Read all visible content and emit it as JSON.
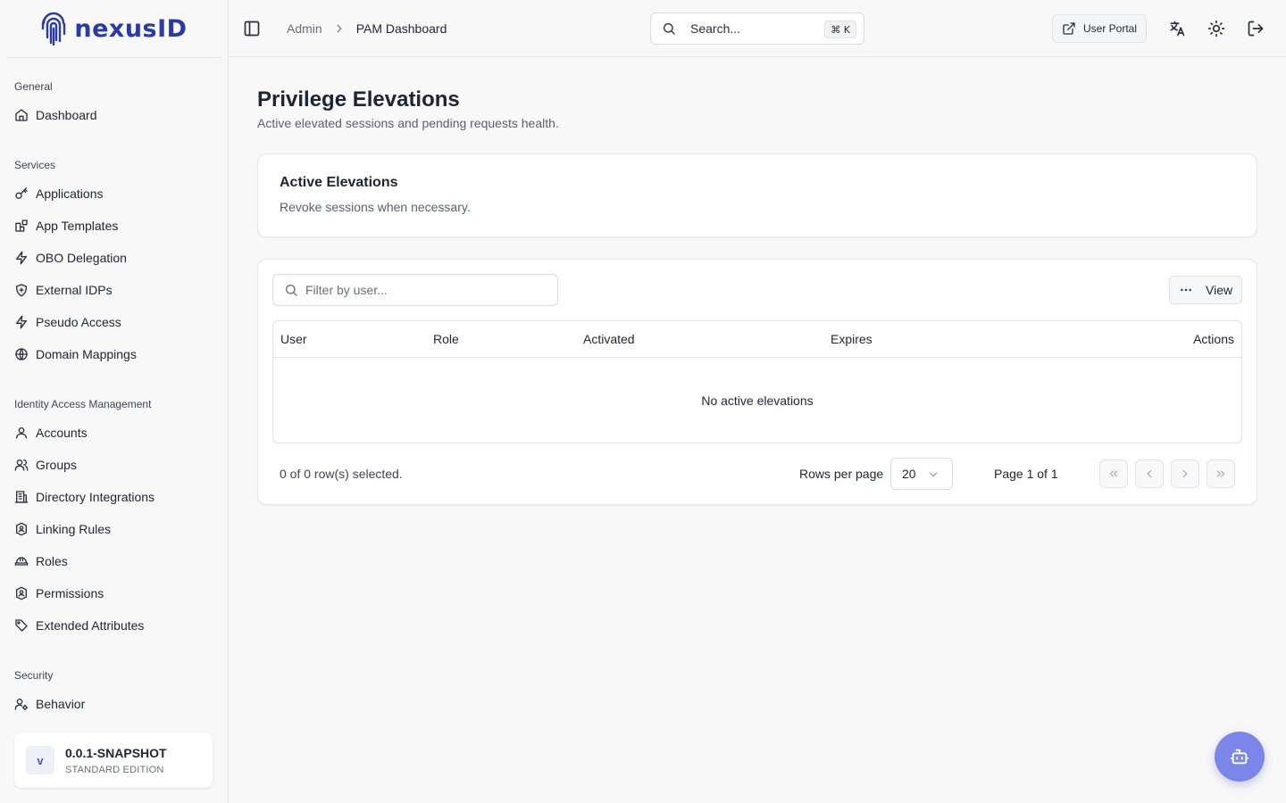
{
  "app": {
    "logo_text": "nexusID"
  },
  "sidebar": {
    "sections": [
      {
        "heading": "General",
        "items": [
          {
            "label": "Dashboard",
            "icon": "home-icon"
          }
        ]
      },
      {
        "heading": "Services",
        "items": [
          {
            "label": "Applications",
            "icon": "key-icon"
          },
          {
            "label": "App Templates",
            "icon": "blocks-icon"
          },
          {
            "label": "OBO Delegation",
            "icon": "zap-icon"
          },
          {
            "label": "External IDPs",
            "icon": "shield-plus-icon"
          },
          {
            "label": "Pseudo Access",
            "icon": "zap-icon"
          },
          {
            "label": "Domain Mappings",
            "icon": "globe-icon"
          }
        ]
      },
      {
        "heading": "Identity Access Management",
        "items": [
          {
            "label": "Accounts",
            "icon": "user-icon"
          },
          {
            "label": "Groups",
            "icon": "users-icon"
          },
          {
            "label": "Directory Integrations",
            "icon": "building-icon"
          },
          {
            "label": "Linking Rules",
            "icon": "badge-icon"
          },
          {
            "label": "Roles",
            "icon": "hard-hat-icon"
          },
          {
            "label": "Permissions",
            "icon": "badge-icon"
          },
          {
            "label": "Extended Attributes",
            "icon": "tag-icon"
          }
        ]
      },
      {
        "heading": "Security",
        "items": [
          {
            "label": "Behavior",
            "icon": "user-cog-icon"
          }
        ]
      }
    ],
    "version": {
      "avatar": "v",
      "title": "0.0.1-SNAPSHOT",
      "subtitle": "STANDARD EDITION"
    }
  },
  "header": {
    "breadcrumb": {
      "root": "Admin",
      "current": "PAM Dashboard"
    },
    "search": {
      "placeholder": "Search...",
      "shortcut": "⌘ K"
    },
    "user_portal_label": "User Portal"
  },
  "page": {
    "title": "Privilege Elevations",
    "subtitle": "Active elevated sessions and pending requests health."
  },
  "active_card": {
    "title": "Active Elevations",
    "subtitle": "Revoke sessions when necessary."
  },
  "table": {
    "filter_placeholder": "Filter by user...",
    "view_label": "View",
    "columns": [
      "User",
      "Role",
      "Activated",
      "Expires",
      "Actions"
    ],
    "empty_text": "No active elevations",
    "selection_text": "0 of 0 row(s) selected.",
    "rows_per_page_label": "Rows per page",
    "rows_per_page_value": "20",
    "page_info": "Page 1 of 1"
  },
  "colors": {
    "accent": "#2b3aa7",
    "fab": "#7c86e8"
  }
}
